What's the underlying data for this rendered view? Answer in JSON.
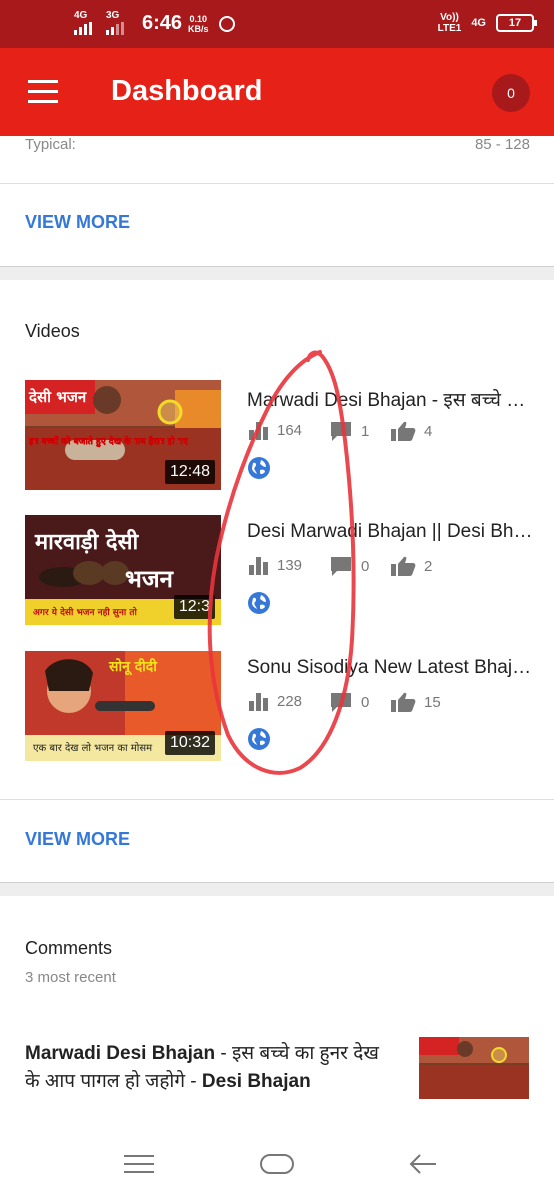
{
  "status_bar": {
    "sim1_label": "4G",
    "sim2_label": "3G",
    "sim2_sub": "R",
    "time": "6:46",
    "speed_value": "0.10",
    "speed_unit": "KB/s",
    "volte_top": "Vo))",
    "volte_bottom": "LTE1",
    "net_label": "4G",
    "battery": "17"
  },
  "app_bar": {
    "title": "Dashboard",
    "badge_count": "0"
  },
  "overview": {
    "typical_label": "Typical:",
    "typical_value": "85 - 128",
    "view_more": "VIEW MORE"
  },
  "videos": {
    "section_title": "Videos",
    "view_more": "VIEW MORE",
    "items": [
      {
        "title": "Marwadi Desi Bhajan - इस बच्चे का हुनर देख के आप पागल हो जहोगे",
        "views": "164",
        "comments": "1",
        "likes": "4",
        "duration": "12:48",
        "visibility_icon": "globe-icon"
      },
      {
        "title": "Desi Marwadi Bhajan || Desi Bhajan",
        "views": "139",
        "comments": "0",
        "likes": "2",
        "duration": "12:3",
        "visibility_icon": "globe-icon"
      },
      {
        "title": "Sonu Sisodiya New Latest Bhajan",
        "views": "228",
        "comments": "0",
        "likes": "15",
        "duration": "10:32",
        "visibility_icon": "globe-icon"
      }
    ],
    "thumbnail_text": {
      "t1_caption": "देसी भजन",
      "t1_sub": "इन बच्चों को बजाते हुए देख के सब हैरान हो गए",
      "t2_caption": "मारवाड़ी देसी",
      "t2_caption2": "भजन",
      "t2_sub": "अगर ये देसी भजन नही सुना तो",
      "t3_caption": "सोनू दीदी",
      "t3_sub": "एक बार देख लो भजन का मोसम"
    }
  },
  "comments": {
    "section_title": "Comments",
    "subtitle": "3 most recent",
    "first_title_bold": "Marwadi Desi Bhajan",
    "first_title_rest": " - इस बच्चे का हुनर देख के आप पागल हो जहोगे - ",
    "first_title_channel": "Desi Bhajan"
  },
  "colors": {
    "status_bar": "#a8191c",
    "app_bar": "#e62117",
    "link": "#3578d8",
    "annotation": "#e8343c"
  }
}
